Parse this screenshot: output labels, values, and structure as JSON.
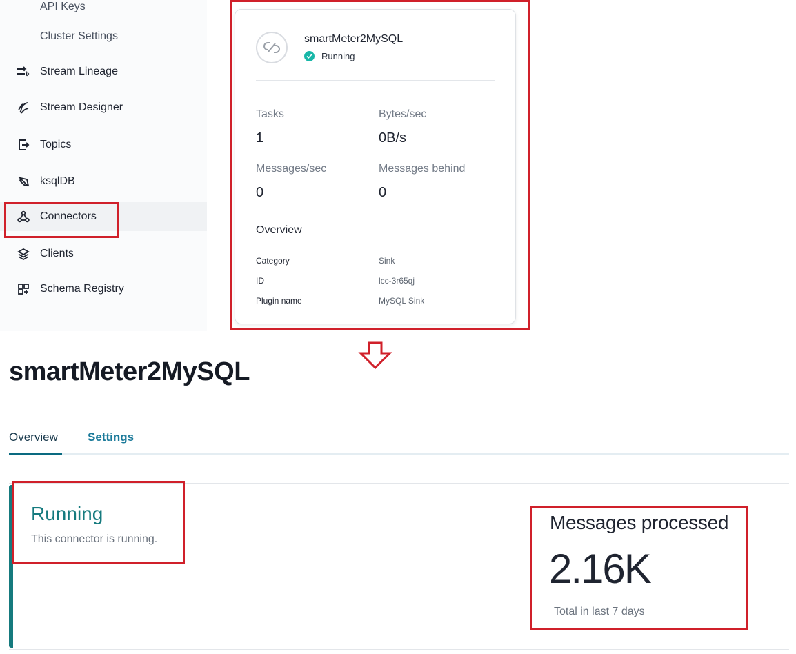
{
  "sidebar": {
    "sub_items": [
      "API Keys",
      "Cluster Settings"
    ],
    "items": [
      {
        "label": "Stream Lineage",
        "icon": "stream-lineage-icon"
      },
      {
        "label": "Stream Designer",
        "icon": "stream-designer-icon"
      },
      {
        "label": "Topics",
        "icon": "topics-icon"
      },
      {
        "label": "ksqlDB",
        "icon": "ksqldb-icon"
      },
      {
        "label": "Connectors",
        "icon": "connectors-icon",
        "active": true
      },
      {
        "label": "Clients",
        "icon": "clients-icon"
      },
      {
        "label": "Schema Registry",
        "icon": "schema-registry-icon"
      }
    ]
  },
  "card": {
    "title": "smartMeter2MySQL",
    "status": "Running",
    "stats": {
      "tasks_label": "Tasks",
      "tasks_value": "1",
      "bytes_label": "Bytes/sec",
      "bytes_value": "0B/s",
      "messages_label": "Messages/sec",
      "messages_value": "0",
      "behind_label": "Messages behind",
      "behind_value": "0"
    },
    "overview_title": "Overview",
    "overview": [
      {
        "key": "Category",
        "value": "Sink"
      },
      {
        "key": "ID",
        "value": "lcc-3r65qj"
      },
      {
        "key": "Plugin name",
        "value": "MySQL Sink"
      }
    ]
  },
  "page": {
    "title": "smartMeter2MySQL",
    "tabs": [
      "Overview",
      "Settings"
    ],
    "status_title": "Running",
    "status_desc": "This connector is running.",
    "messages_title": "Messages processed",
    "messages_value": "2.16K",
    "messages_sub": "Total in last 7 days"
  },
  "colors": {
    "accent_teal": "#157a7e",
    "highlight_red": "#d0202a",
    "status_check": "#18b7a8"
  }
}
